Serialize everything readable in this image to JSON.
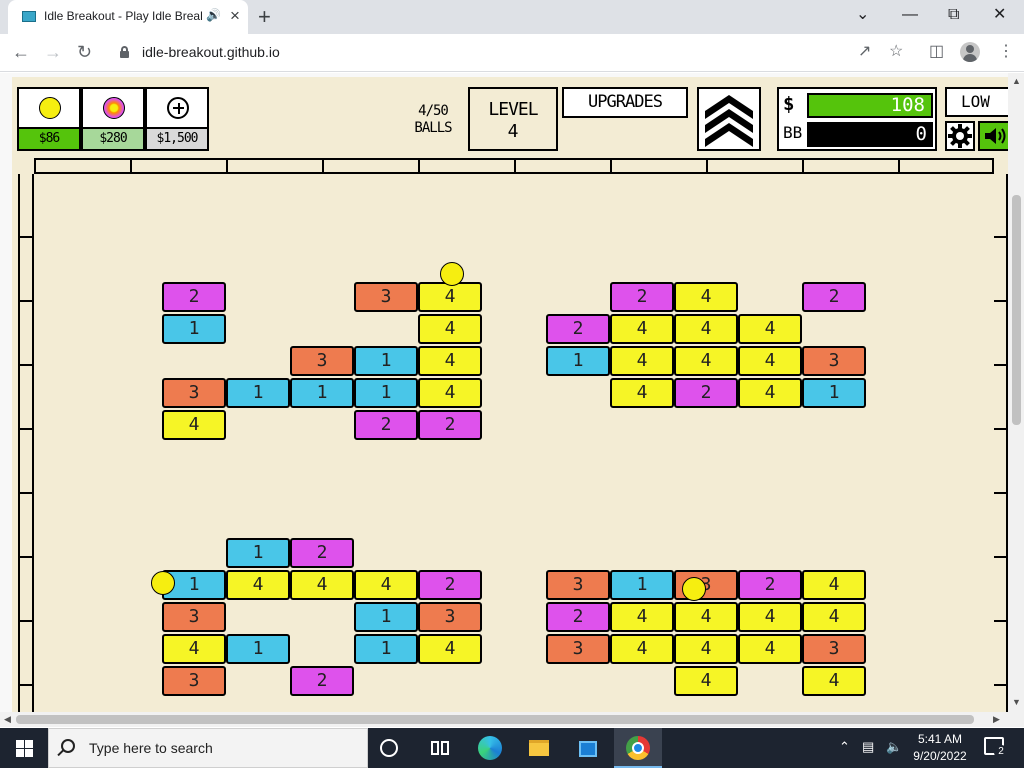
{
  "browser": {
    "tab_title": "Idle Breakout - Play Idle Breakout",
    "url": "idle-breakout.github.io"
  },
  "hud": {
    "ball_shop": [
      {
        "name": "basic-ball",
        "price": "$86",
        "color": "#f6ee10",
        "price_bg": "#55c40c"
      },
      {
        "name": "plasma-ball",
        "price": "$280",
        "color": "#de52ec",
        "price_bg": "#a7d89a"
      },
      {
        "name": "add-ball",
        "price": "$1,500",
        "price_bg": "#d9d9d9"
      }
    ],
    "balls_count": "4/50",
    "balls_label": "BALLS",
    "level_label": "LEVEL",
    "level_value": "4",
    "upgrades_label": "UPGRADES",
    "money_symbol": "$",
    "money_value": "108",
    "bb_symbol": "BB",
    "bb_value": "0",
    "quality_label": "LOW"
  },
  "colors": {
    "brick_1": "#49c6e8",
    "brick_2": "#de52ec",
    "brick_3": "#ee7b4f",
    "brick_4": "#f6f526",
    "money_green": "#55c40c",
    "field_bg": "#f3ecd4"
  },
  "game": {
    "bricks": [
      {
        "col": 0,
        "row": 0,
        "hp": "2"
      },
      {
        "col": 0,
        "row": 1,
        "hp": "1"
      },
      {
        "col": 3,
        "row": 0,
        "hp": "3"
      },
      {
        "col": 4,
        "row": 0,
        "hp": "4"
      },
      {
        "col": 4,
        "row": 1,
        "hp": "4"
      },
      {
        "col": 2,
        "row": 2,
        "hp": "3"
      },
      {
        "col": 3,
        "row": 2,
        "hp": "1"
      },
      {
        "col": 4,
        "row": 2,
        "hp": "4"
      },
      {
        "col": 0,
        "row": 3,
        "hp": "3"
      },
      {
        "col": 1,
        "row": 3,
        "hp": "1"
      },
      {
        "col": 2,
        "row": 3,
        "hp": "1"
      },
      {
        "col": 3,
        "row": 3,
        "hp": "1"
      },
      {
        "col": 4,
        "row": 3,
        "hp": "4"
      },
      {
        "col": 0,
        "row": 4,
        "hp": "4"
      },
      {
        "col": 3,
        "row": 4,
        "hp": "2"
      },
      {
        "col": 4,
        "row": 4,
        "hp": "2"
      },
      {
        "col": 7,
        "row": 0,
        "hp": "2"
      },
      {
        "col": 8,
        "row": 0,
        "hp": "4"
      },
      {
        "col": 10,
        "row": 0,
        "hp": "2"
      },
      {
        "col": 6,
        "row": 1,
        "hp": "2"
      },
      {
        "col": 7,
        "row": 1,
        "hp": "4"
      },
      {
        "col": 8,
        "row": 1,
        "hp": "4"
      },
      {
        "col": 9,
        "row": 1,
        "hp": "4"
      },
      {
        "col": 6,
        "row": 2,
        "hp": "1"
      },
      {
        "col": 7,
        "row": 2,
        "hp": "4"
      },
      {
        "col": 8,
        "row": 2,
        "hp": "4"
      },
      {
        "col": 9,
        "row": 2,
        "hp": "4"
      },
      {
        "col": 10,
        "row": 2,
        "hp": "3"
      },
      {
        "col": 7,
        "row": 3,
        "hp": "4"
      },
      {
        "col": 8,
        "row": 3,
        "hp": "2"
      },
      {
        "col": 9,
        "row": 3,
        "hp": "4"
      },
      {
        "col": 10,
        "row": 3,
        "hp": "1"
      },
      {
        "col": 1,
        "row": 7,
        "hp": "1"
      },
      {
        "col": 2,
        "row": 7,
        "hp": "2"
      },
      {
        "col": 0,
        "row": 8,
        "hp": "1"
      },
      {
        "col": 1,
        "row": 8,
        "hp": "4"
      },
      {
        "col": 2,
        "row": 8,
        "hp": "4"
      },
      {
        "col": 3,
        "row": 8,
        "hp": "4"
      },
      {
        "col": 4,
        "row": 8,
        "hp": "2"
      },
      {
        "col": 0,
        "row": 9,
        "hp": "3"
      },
      {
        "col": 3,
        "row": 9,
        "hp": "1"
      },
      {
        "col": 4,
        "row": 9,
        "hp": "3"
      },
      {
        "col": 0,
        "row": 10,
        "hp": "4"
      },
      {
        "col": 1,
        "row": 10,
        "hp": "1"
      },
      {
        "col": 3,
        "row": 10,
        "hp": "1"
      },
      {
        "col": 4,
        "row": 10,
        "hp": "4"
      },
      {
        "col": 0,
        "row": 11,
        "hp": "3"
      },
      {
        "col": 2,
        "row": 11,
        "hp": "2"
      },
      {
        "col": 6,
        "row": 8,
        "hp": "3"
      },
      {
        "col": 7,
        "row": 8,
        "hp": "1"
      },
      {
        "col": 8,
        "row": 8,
        "hp": "3"
      },
      {
        "col": 9,
        "row": 8,
        "hp": "2"
      },
      {
        "col": 10,
        "row": 8,
        "hp": "4"
      },
      {
        "col": 6,
        "row": 9,
        "hp": "2"
      },
      {
        "col": 7,
        "row": 9,
        "hp": "4"
      },
      {
        "col": 8,
        "row": 9,
        "hp": "4"
      },
      {
        "col": 9,
        "row": 9,
        "hp": "4"
      },
      {
        "col": 10,
        "row": 9,
        "hp": "4"
      },
      {
        "col": 6,
        "row": 10,
        "hp": "3"
      },
      {
        "col": 7,
        "row": 10,
        "hp": "4"
      },
      {
        "col": 8,
        "row": 10,
        "hp": "4"
      },
      {
        "col": 9,
        "row": 10,
        "hp": "4"
      },
      {
        "col": 10,
        "row": 10,
        "hp": "3"
      },
      {
        "col": 8,
        "row": 11,
        "hp": "4"
      },
      {
        "col": 10,
        "row": 11,
        "hp": "4"
      }
    ]
  },
  "taskbar": {
    "search_placeholder": "Type here to search",
    "time": "5:41 AM",
    "date": "9/20/2022",
    "notifications": "2"
  }
}
